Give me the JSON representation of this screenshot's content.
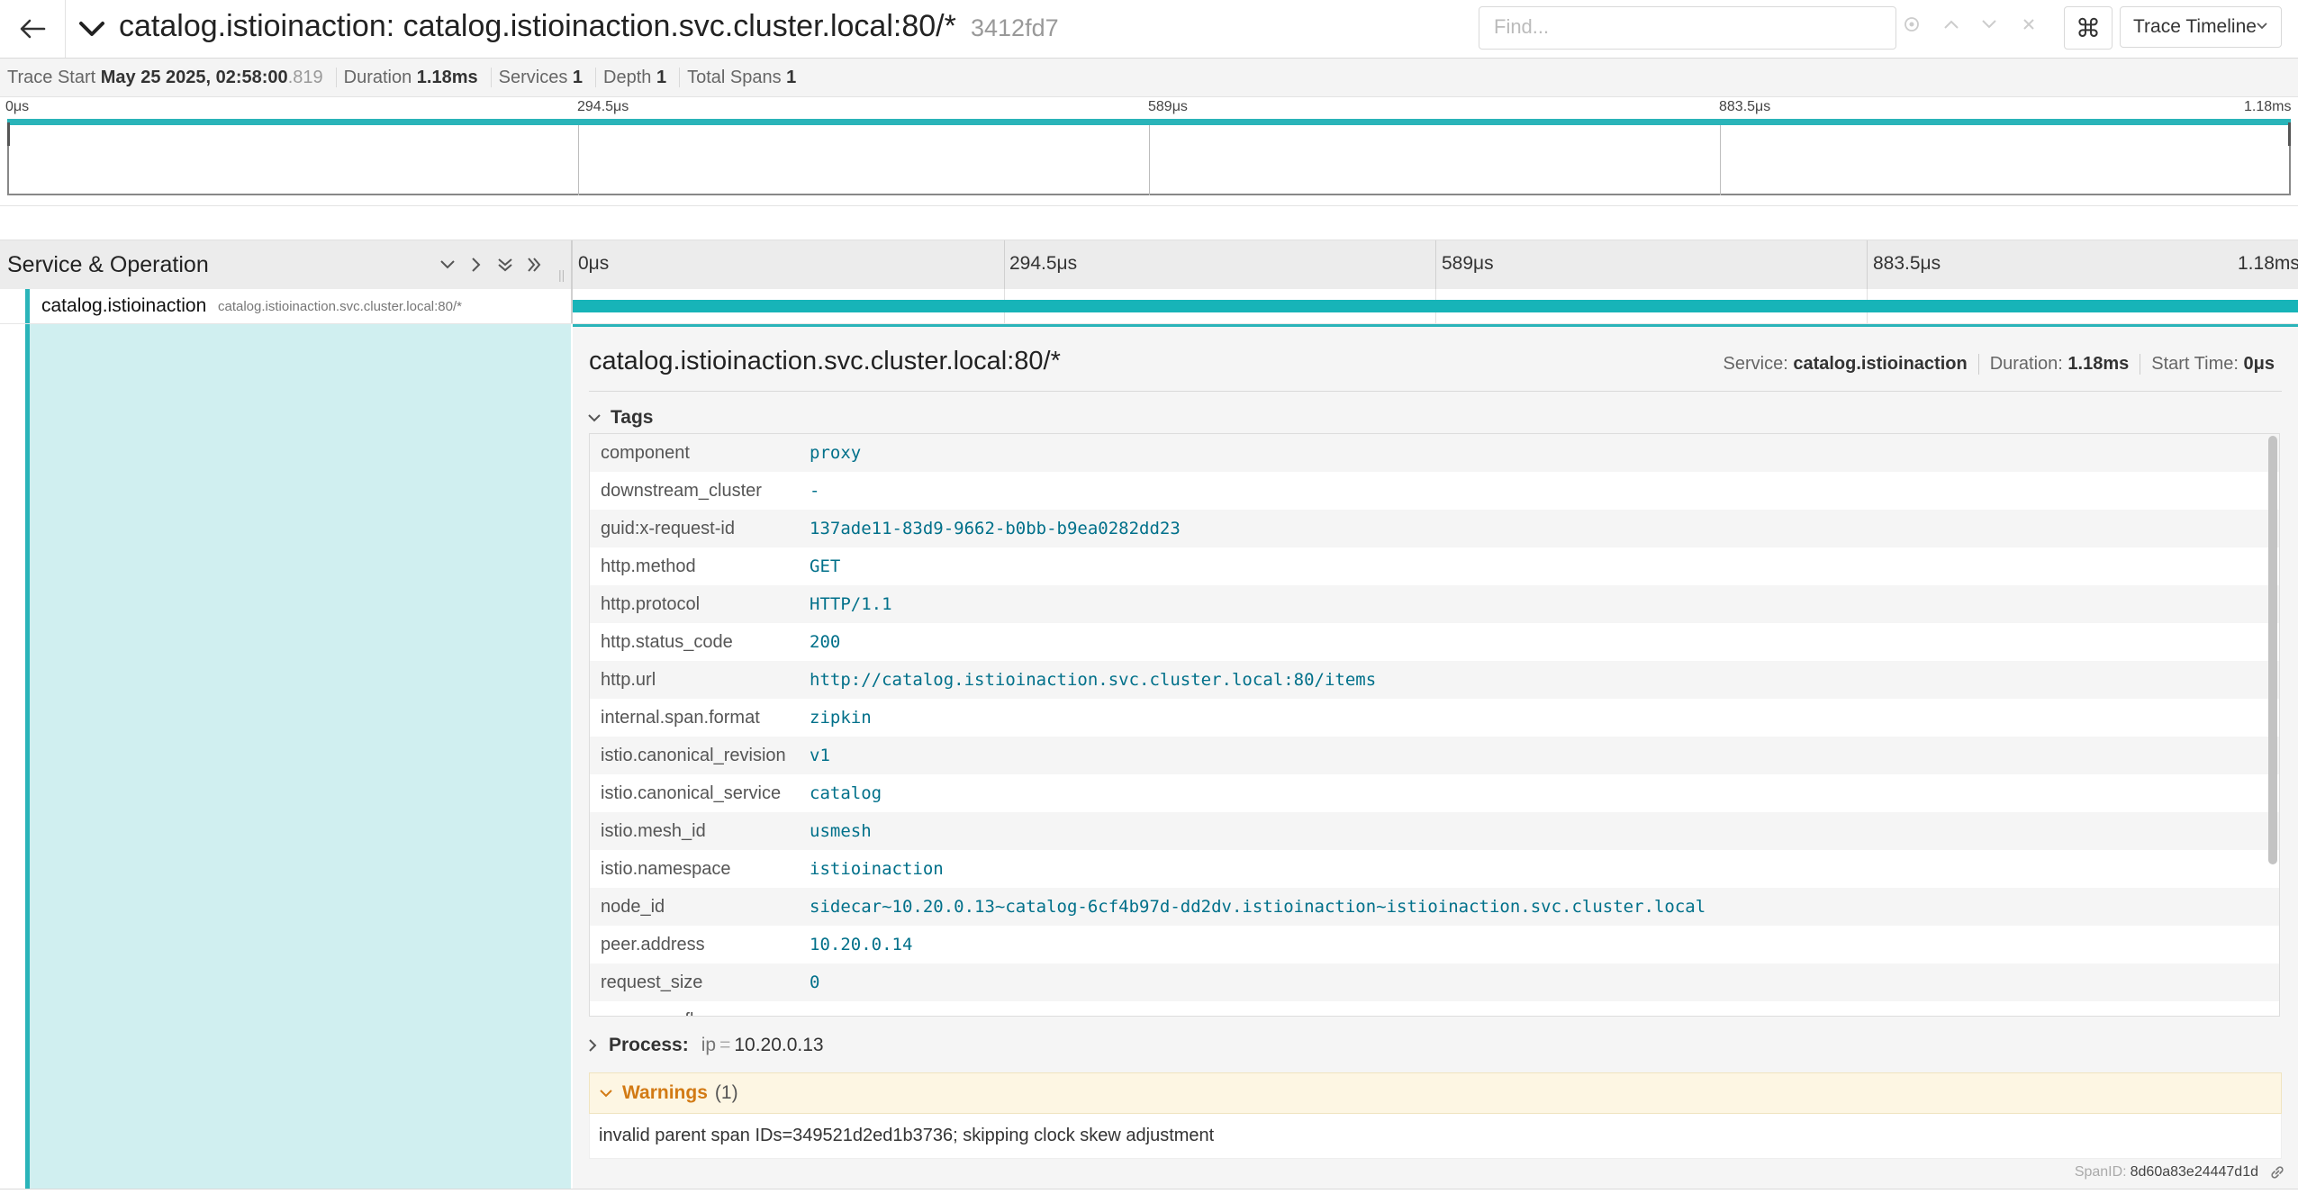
{
  "header": {
    "title": "catalog.istioinaction: catalog.istioinaction.svc.cluster.local:80/*",
    "trace_id": "3412fd7",
    "find_placeholder": "Find...",
    "keyboard_shortcut_glyph": "⌘",
    "view_label": "Trace Timeline",
    "icons": [
      "back-arrow-icon",
      "chevron-down-icon",
      "locate-icon",
      "chevron-up-icon",
      "chevron-down-icon",
      "close-icon",
      "command-icon"
    ]
  },
  "overview": {
    "trace_start_label": "Trace Start",
    "trace_start_value": "May 25 2025, 02:58:00",
    "trace_start_ms": ".819",
    "duration_label": "Duration",
    "duration_value": "1.18ms",
    "services_label": "Services",
    "services_value": "1",
    "depth_label": "Depth",
    "depth_value": "1",
    "total_spans_label": "Total Spans",
    "total_spans_value": "1"
  },
  "minimap": {
    "ticks": [
      "0μs",
      "294.5μs",
      "589μs",
      "883.5μs",
      "1.18ms"
    ]
  },
  "timeline": {
    "column_title": "Service & Operation",
    "ticks": [
      "0μs",
      "294.5μs",
      "589μs",
      "883.5μs",
      "1.18ms"
    ],
    "controls": [
      "collapse-one-icon",
      "expand-one-icon",
      "collapse-all-icon",
      "expand-all-icon"
    ]
  },
  "span": {
    "service": "catalog.istioinaction",
    "operation": "catalog.istioinaction.svc.cluster.local:80/*",
    "bar_color": "#17b4b8"
  },
  "detail": {
    "title": "catalog.istioinaction.svc.cluster.local:80/*",
    "service_label": "Service:",
    "service_value": "catalog.istioinaction",
    "duration_label": "Duration:",
    "duration_value": "1.18ms",
    "start_label": "Start Time:",
    "start_value": "0μs",
    "tags_label": "Tags",
    "tags": [
      {
        "key": "component",
        "value": "proxy"
      },
      {
        "key": "downstream_cluster",
        "value": "-"
      },
      {
        "key": "guid:x-request-id",
        "value": "137ade11-83d9-9662-b0bb-b9ea0282dd23"
      },
      {
        "key": "http.method",
        "value": "GET"
      },
      {
        "key": "http.protocol",
        "value": "HTTP/1.1"
      },
      {
        "key": "http.status_code",
        "value": "200"
      },
      {
        "key": "http.url",
        "value": "http://catalog.istioinaction.svc.cluster.local:80/items"
      },
      {
        "key": "internal.span.format",
        "value": "zipkin"
      },
      {
        "key": "istio.canonical_revision",
        "value": "v1"
      },
      {
        "key": "istio.canonical_service",
        "value": "catalog"
      },
      {
        "key": "istio.mesh_id",
        "value": "usmesh"
      },
      {
        "key": "istio.namespace",
        "value": "istioinaction"
      },
      {
        "key": "node_id",
        "value": "sidecar~10.20.0.13~catalog-6cf4b97d-dd2dv.istioinaction~istioinaction.svc.cluster.local"
      },
      {
        "key": "peer.address",
        "value": "10.20.0.14"
      },
      {
        "key": "request_size",
        "value": "0"
      },
      {
        "key": "response_flags",
        "value": ""
      }
    ],
    "process_label": "Process:",
    "process_key": "ip",
    "process_eq": "=",
    "process_value": "10.20.0.13",
    "warnings_label": "Warnings",
    "warnings_count": "(1)",
    "warning_text": "invalid parent span IDs=349521d2ed1b3736; skipping clock skew adjustment",
    "span_id_label": "SpanID:",
    "span_id_value": "8d60a83e24447d1d"
  },
  "colors": {
    "accent": "#2ab4b9",
    "tag_value": "#00708a",
    "warning": "#d27a14"
  }
}
